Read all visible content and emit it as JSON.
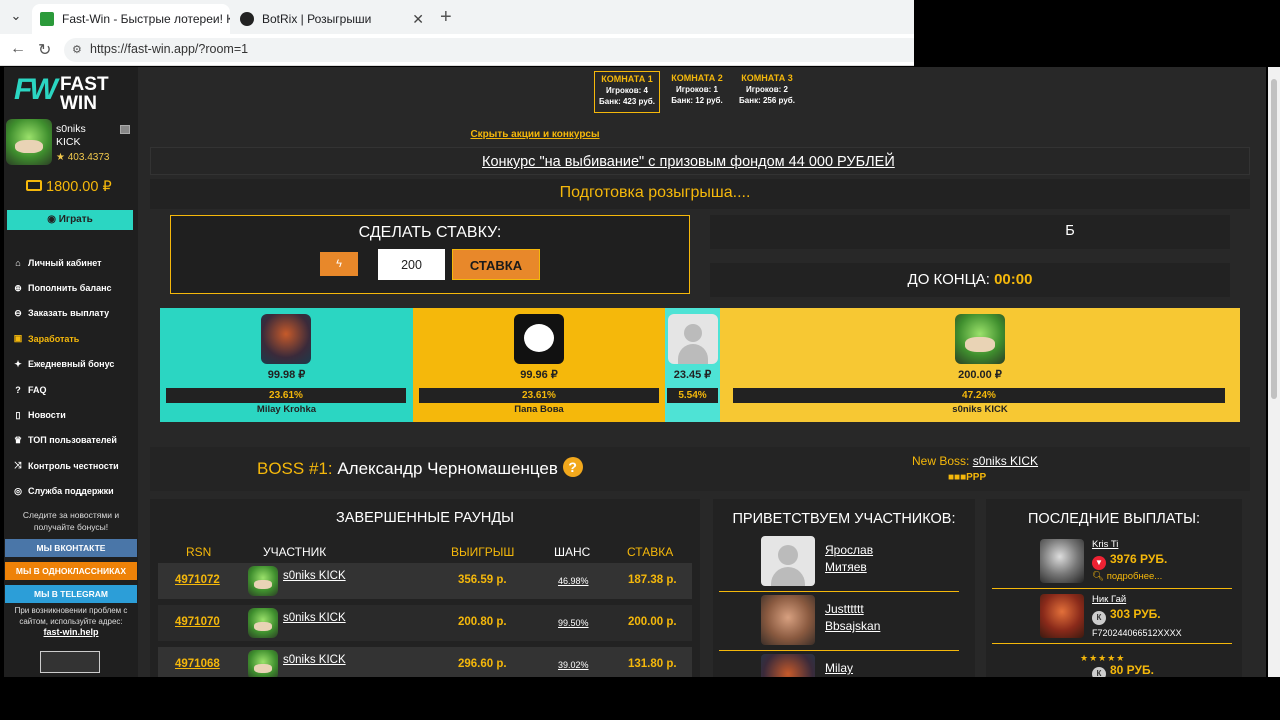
{
  "browser": {
    "tabs": [
      {
        "title": "Fast-Win - Быстрые лотереи! Ком",
        "active": true
      },
      {
        "title": "BotRix | Розыгрыши",
        "active": false
      }
    ],
    "url": "https://fast-win.app/?room=1"
  },
  "logo": {
    "text": "FAST WIN"
  },
  "user": {
    "name": "s0niks",
    "tag": "KICK",
    "rating": "★ 403.4373",
    "balance": "1800.00 ₽"
  },
  "sidebar": {
    "play_label": "Играть",
    "items": [
      {
        "label": "Личный кабинет",
        "icon": "home-icon"
      },
      {
        "label": "Пополнить баланс",
        "icon": "plus-icon"
      },
      {
        "label": "Заказать выплату",
        "icon": "download-icon"
      },
      {
        "label": "Заработать",
        "icon": "wallet-icon"
      },
      {
        "label": "Ежедневный бонус",
        "icon": "gift-icon"
      },
      {
        "label": "FAQ",
        "icon": "question-icon"
      },
      {
        "label": "Новости",
        "icon": "bookmark-icon"
      },
      {
        "label": "ТОП пользователей",
        "icon": "trophy-icon"
      },
      {
        "label": "Контроль честности",
        "icon": "shuffle-icon"
      },
      {
        "label": "Служба поддержки",
        "icon": "globe-icon"
      }
    ],
    "news_text": "Следите за новостями и получайте бонусы!",
    "social": [
      {
        "label": "МЫ ВКОНТАКТЕ",
        "color": "#4a76a8"
      },
      {
        "label": "МЫ В ОДНОКЛАССНИКАХ",
        "color": "#ee8208"
      },
      {
        "label": "МЫ В TELEGRAM",
        "color": "#2c9ed8"
      }
    ],
    "help_text": "При возникновении проблем с сайтом, используйте адрес:",
    "help_link": "fast-win.help"
  },
  "rooms": [
    {
      "title": "КОМНАТА 1",
      "players": "Игроков: 4",
      "bank": "Банк: 423 руб.",
      "selected": true
    },
    {
      "title": "КОМНАТА 2",
      "players": "Игроков: 1",
      "bank": "Банк: 12 руб.",
      "selected": false
    },
    {
      "title": "КОМНАТА 3",
      "players": "Игроков: 2",
      "bank": "Банк: 256 руб.",
      "selected": false
    }
  ],
  "promo": {
    "toggle": "Скрыть акции и конкурсы",
    "contest": "Конкурс \"на выбивание\" с призовым фондом 44 000 РУБЛЕЙ",
    "status": "Подготовка розыгрыша...."
  },
  "bet": {
    "title": "СДЕЛАТЬ СТАВКУ:",
    "value": "200",
    "button": "СТАВКА",
    "bolt": "ϟ"
  },
  "right_boxes": {
    "bank_partial": "Б",
    "timer_label": "ДО КОНЦА:",
    "timer_value": "00:00"
  },
  "players": [
    {
      "value": "99.98 ₽",
      "chance": "23.61%",
      "name": "Milay Krohka",
      "bg": "#2bd6c2"
    },
    {
      "value": "99.96 ₽",
      "chance": "23.61%",
      "name": "Папа Вова",
      "bg": "#f5b80b"
    },
    {
      "value": "23.45 ₽",
      "chance": "5.54%",
      "name": "",
      "bg": "#4ee3d5"
    },
    {
      "value": "200.00 ₽",
      "chance": "47.24%",
      "name": "s0niks KICK",
      "bg": "#f7c833"
    }
  ],
  "boss": {
    "label": "BOSS #1:",
    "name": "Александр Черномашенцев",
    "q": "?",
    "new_boss_label": "New Boss:",
    "new_boss_name": "s0niks KICK",
    "indicator": "■■■PPP"
  },
  "rounds": {
    "title": "ЗАВЕРШЕННЫЕ РАУНДЫ",
    "headers": {
      "rsn": "RSN",
      "player": "УЧАСТНИК",
      "win": "ВЫИГРЫШ",
      "chance": "ШАНС",
      "bet": "СТАВКА"
    },
    "rows": [
      {
        "rsn": "4971072",
        "name": "s0niks KICK",
        "win": "356.59 р.",
        "chance": "46.98%",
        "bet": "187.38 р."
      },
      {
        "rsn": "4971070",
        "name": "s0niks KICK",
        "win": "200.80 р.",
        "chance": "99.50%",
        "bet": "200.00 р."
      },
      {
        "rsn": "4971068",
        "name": "s0niks KICK",
        "win": "296.60 р.",
        "chance": "39.02%",
        "bet": "131.80 р."
      }
    ]
  },
  "welcome": {
    "title": "ПРИВЕТСТВУЕМ УЧАСТНИКОВ:",
    "users": [
      {
        "first": "Ярослав",
        "last": "Митяев"
      },
      {
        "first": "Justttttt",
        "last": "Bbsajskan"
      },
      {
        "first": "Milay",
        "last": ""
      }
    ]
  },
  "payouts": {
    "title": "ПОСЛЕДНИЕ ВЫПЛАТЫ:",
    "items": [
      {
        "name": "Kris Ti",
        "amount": "3976 РУБ.",
        "extra": "подробнее..."
      },
      {
        "name": "Ник Гай",
        "amount": "303 РУБ.",
        "extra": "F720244066512XXXX"
      },
      {
        "name": "",
        "amount": "80 РУБ.",
        "extra": ""
      }
    ],
    "stars": "★★★★★"
  }
}
